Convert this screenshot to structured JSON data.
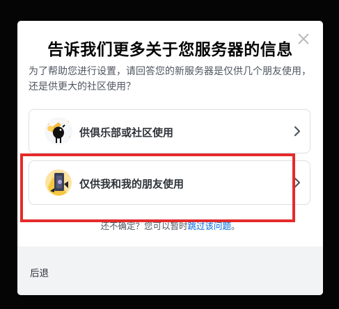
{
  "dialog": {
    "title": "告诉我们更多关于您服务器的信息",
    "subtitle": "为了帮助您进行设置，请回答您的新服务器是仅供几个朋友使用，还是供更大的社区使用？",
    "options": [
      {
        "label": "供俱乐部或社区使用",
        "icon": "club-community-icon"
      },
      {
        "label": "仅供我和我的朋友使用",
        "icon": "friends-icon"
      }
    ],
    "skip_prefix": "还不确定？您可以暂时",
    "skip_link": "跳过该问题",
    "skip_suffix": "。",
    "back_label": "后退"
  },
  "colors": {
    "overlay": "#050505",
    "modal_bg": "#ffffff",
    "footer_bg": "#f2f3f5",
    "link": "#0068e0",
    "highlight": "#e52a2a"
  }
}
